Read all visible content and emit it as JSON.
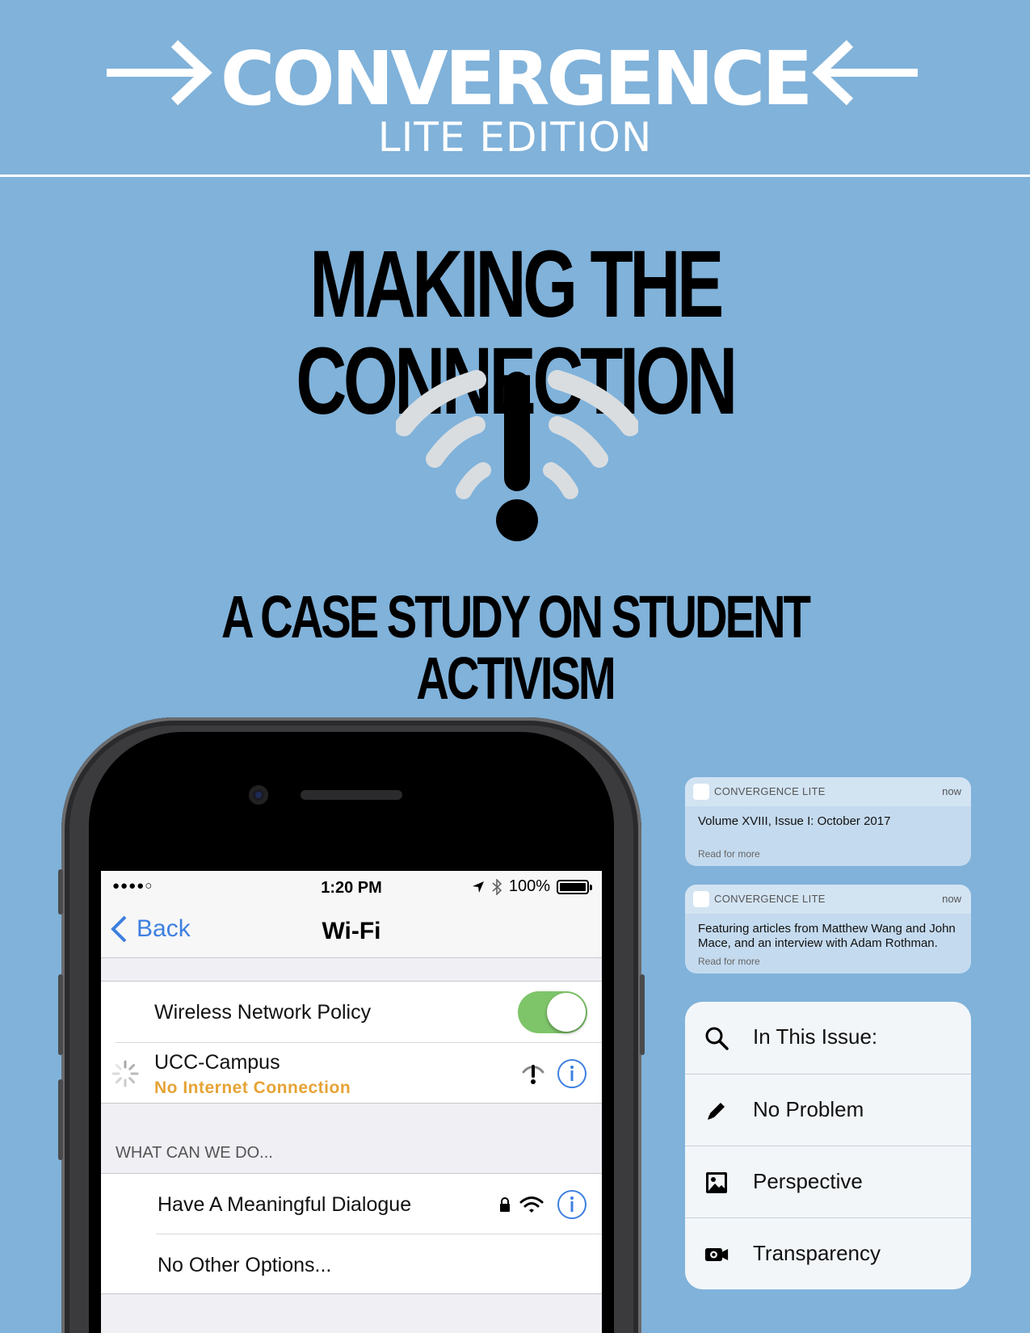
{
  "masthead": {
    "brand": "CONVERGENCE",
    "edition": "LITE EDITION"
  },
  "headline": "MAKING THE CONNECTION",
  "subheadline": "A CASE STUDY ON STUDENT ACTIVISM",
  "phone": {
    "status_bar": {
      "time": "1:20 PM",
      "battery": "100%",
      "signal": "●●●●○"
    },
    "nav": {
      "back_label": "Back",
      "title": "Wi-Fi"
    },
    "rows": {
      "policy_label": "Wireless Network Policy",
      "policy_enabled": true,
      "network_name": "UCC-Campus",
      "network_status": "No Internet Connection"
    },
    "section_header": "WHAT CAN WE DO...",
    "options": [
      {
        "label": "Have A Meaningful Dialogue"
      },
      {
        "label": "No Other Options..."
      }
    ]
  },
  "notifications": [
    {
      "app": "CONVERGENCE LITE",
      "time": "now",
      "body": "Volume XVIII, Issue I: October 2017",
      "more": "Read for more"
    },
    {
      "app": "CONVERGENCE LITE",
      "time": "now",
      "body": "Featuring articles from Matthew Wang and John Mace, and an interview with Adam Rothman.",
      "more": "Read for more"
    }
  ],
  "menu": {
    "items": [
      {
        "label": "In This Issue:",
        "icon": "search-icon"
      },
      {
        "label": "No Problem",
        "icon": "pencil-icon"
      },
      {
        "label": "Perspective",
        "icon": "image-icon"
      },
      {
        "label": "Transparency",
        "icon": "video-camera-icon"
      }
    ]
  },
  "colors": {
    "background": "#80b2da",
    "ios_blue": "#3d7fe0",
    "toggle_green": "#7ec56a",
    "warning_orange": "#e6a335",
    "wifi_gray": "#d9dde0"
  }
}
